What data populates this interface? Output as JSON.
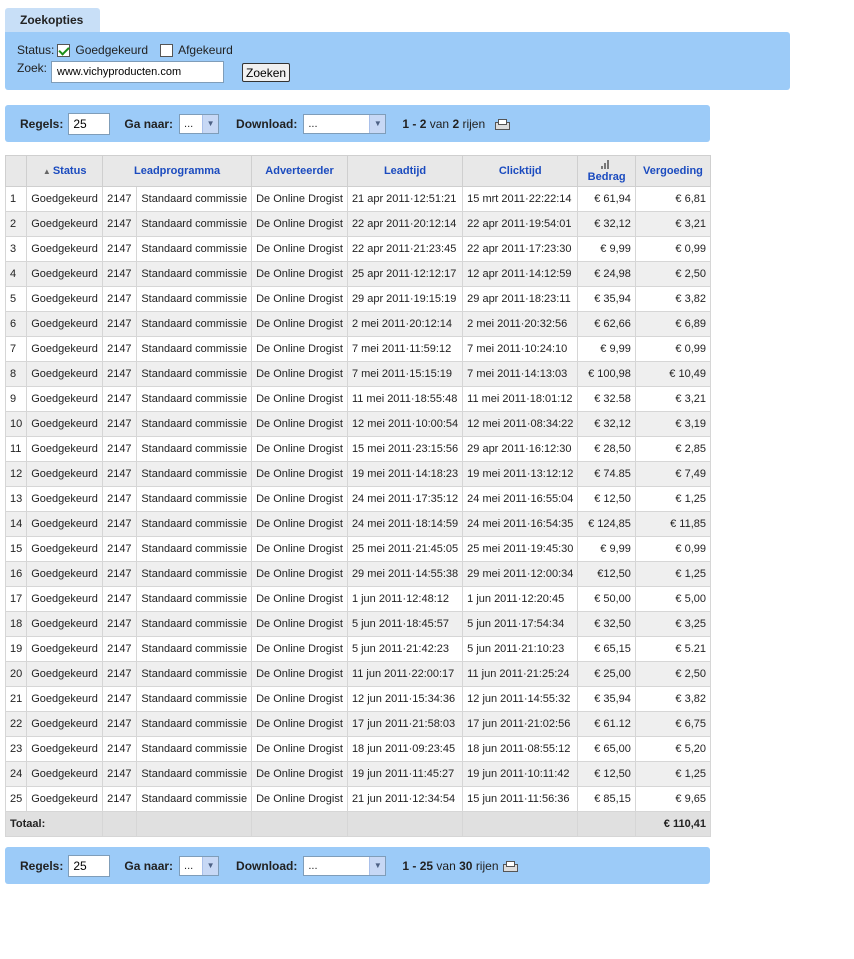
{
  "search": {
    "tab_label": "Zoekopties",
    "status_label": "Status:",
    "goedgekeurd_label": "Goedgekeurd",
    "afgekeurd_label": "Afgekeurd",
    "zoek_label": "Zoek:",
    "zoek_value": "www.vichyproducten.com",
    "zoek_button": "Zoeken"
  },
  "pager_top": {
    "regels_label": "Regels:",
    "regels_value": "25",
    "ganaar_label": "Ga naar:",
    "ganaar_value": "...",
    "download_label": "Download:",
    "download_value": "...",
    "range": "1 - 2",
    "van": "van",
    "total": "2",
    "rijen": "rijen"
  },
  "pager_bottom": {
    "regels_label": "Regels:",
    "regels_value": "25",
    "ganaar_label": "Ga naar:",
    "ganaar_value": "...",
    "download_label": "Download:",
    "download_value": "...",
    "range": "1 - 25",
    "van": "van",
    "total": "30",
    "rijen": "rijen"
  },
  "table": {
    "headers": {
      "status": "Status",
      "leadprogramma": "Leadprogramma",
      "adverteerder": "Adverteerder",
      "leadtijd": "Leadtijd",
      "clicktijd": "Clicktijd",
      "bedrag": "Bedrag",
      "vergoeding": "Vergoeding"
    },
    "rows": [
      [
        "1",
        "Goedgekeurd",
        "2147",
        "Standaard commissie",
        "De Online Drogist",
        "21 apr 2011·12:51:21",
        "15 mrt 2011·22:22:14",
        "€ 61,94",
        "€ 6,81"
      ],
      [
        "2",
        "Goedgekeurd",
        "2147",
        "Standaard commissie",
        "De Online Drogist",
        "22 apr 2011·20:12:14",
        "22 apr 2011·19:54:01",
        "€ 32,12",
        "€ 3,21"
      ],
      [
        "3",
        "Goedgekeurd",
        "2147",
        "Standaard commissie",
        "De Online Drogist",
        "22 apr 2011·21:23:45",
        "22 apr 2011·17:23:30",
        "€ 9,99",
        "€ 0,99"
      ],
      [
        "4",
        "Goedgekeurd",
        "2147",
        "Standaard commissie",
        "De Online Drogist",
        "25 apr 2011·12:12:17",
        "12 apr 2011·14:12:59",
        "€ 24,98",
        "€ 2,50"
      ],
      [
        "5",
        "Goedgekeurd",
        "2147",
        "Standaard commissie",
        "De Online Drogist",
        "29 apr 2011·19:15:19",
        "29 apr 2011·18:23:11",
        "€ 35,94",
        "€ 3,82"
      ],
      [
        "6",
        "Goedgekeurd",
        "2147",
        "Standaard commissie",
        "De Online Drogist",
        "2 mei 2011·20:12:14",
        "2 mei 2011·20:32:56",
        "€ 62,66",
        "€ 6,89"
      ],
      [
        "7",
        "Goedgekeurd",
        "2147",
        "Standaard commissie",
        "De Online Drogist",
        "7 mei 2011·11:59:12",
        "7 mei 2011·10:24:10",
        "€ 9,99",
        "€ 0,99"
      ],
      [
        "8",
        "Goedgekeurd",
        "2147",
        "Standaard commissie",
        "De Online Drogist",
        "7 mei 2011·15:15:19",
        "7 mei 2011·14:13:03",
        "€ 100,98",
        "€ 10,49"
      ],
      [
        "9",
        "Goedgekeurd",
        "2147",
        "Standaard commissie",
        "De Online Drogist",
        "11 mei 2011·18:55:48",
        "11 mei 2011·18:01:12",
        "€ 32.58",
        "€ 3,21"
      ],
      [
        "10",
        "Goedgekeurd",
        "2147",
        "Standaard commissie",
        "De Online Drogist",
        "12 mei 2011·10:00:54",
        "12 mei 2011·08:34:22",
        "€ 32,12",
        "€ 3,19"
      ],
      [
        "11",
        "Goedgekeurd",
        "2147",
        "Standaard commissie",
        "De Online Drogist",
        "15 mei 2011·23:15:56",
        "29 apr 2011·16:12:30",
        "€ 28,50",
        "€ 2,85"
      ],
      [
        "12",
        "Goedgekeurd",
        "2147",
        "Standaard commissie",
        "De Online Drogist",
        "19 mei 2011·14:18:23",
        "19 mei 2011·13:12:12",
        "€ 74.85",
        "€ 7,49"
      ],
      [
        "13",
        "Goedgekeurd",
        "2147",
        "Standaard commissie",
        "De Online Drogist",
        "24 mei 2011·17:35:12",
        "24 mei 2011·16:55:04",
        "€ 12,50",
        "€ 1,25"
      ],
      [
        "14",
        "Goedgekeurd",
        "2147",
        "Standaard commissie",
        "De Online Drogist",
        "24 mei 2011·18:14:59",
        "24 mei 2011·16:54:35",
        "€ 124,85",
        "€ 11,85"
      ],
      [
        "15",
        "Goedgekeurd",
        "2147",
        "Standaard commissie",
        "De Online Drogist",
        "25 mei 2011·21:45:05",
        "25 mei 2011·19:45:30",
        "€ 9,99",
        "€ 0,99"
      ],
      [
        "16",
        "Goedgekeurd",
        "2147",
        "Standaard commissie",
        "De Online Drogist",
        "29 mei 2011·14:55:38",
        "29 mei 2011·12:00:34",
        "€12,50",
        "€ 1,25"
      ],
      [
        "17",
        "Goedgekeurd",
        "2147",
        "Standaard commissie",
        "De Online Drogist",
        "1 jun 2011·12:48:12",
        "1 jun 2011·12:20:45",
        "€ 50,00",
        "€ 5,00"
      ],
      [
        "18",
        "Goedgekeurd",
        "2147",
        "Standaard commissie",
        "De Online Drogist",
        "5 jun 2011·18:45:57",
        "5 jun 2011·17:54:34",
        "€ 32,50",
        "€ 3,25"
      ],
      [
        "19",
        "Goedgekeurd",
        "2147",
        "Standaard commissie",
        "De Online Drogist",
        "5 jun 2011·21:42:23",
        "5 jun 2011·21:10:23",
        "€ 65,15",
        "€ 5.21"
      ],
      [
        "20",
        "Goedgekeurd",
        "2147",
        "Standaard commissie",
        "De Online Drogist",
        "11 jun 2011·22:00:17",
        "11 jun 2011·21:25:24",
        "€ 25,00",
        "€ 2,50"
      ],
      [
        "21",
        "Goedgekeurd",
        "2147",
        "Standaard commissie",
        "De Online Drogist",
        "12 jun 2011·15:34:36",
        "12 jun 2011·14:55:32",
        "€ 35,94",
        "€ 3,82"
      ],
      [
        "22",
        "Goedgekeurd",
        "2147",
        "Standaard commissie",
        "De Online Drogist",
        "17 jun 2011·21:58:03",
        "17 jun 2011·21:02:56",
        "€ 61.12",
        "€ 6,75"
      ],
      [
        "23",
        "Goedgekeurd",
        "2147",
        "Standaard commissie",
        "De Online Drogist",
        "18 jun 2011·09:23:45",
        "18 jun 2011·08:55:12",
        "€ 65,00",
        "€ 5,20"
      ],
      [
        "24",
        "Goedgekeurd",
        "2147",
        "Standaard commissie",
        "De Online Drogist",
        "19 jun 2011·11:45:27",
        "19 jun 2011·10:11:42",
        "€ 12,50",
        "€ 1,25"
      ],
      [
        "25",
        "Goedgekeurd",
        "2147",
        "Standaard commissie",
        "De Online Drogist",
        "21 jun 2011·12:34:54",
        "15 jun 2011·11:56:36",
        "€ 85,15",
        "€ 9,65"
      ]
    ],
    "total_label": "Totaal:",
    "total_value": "€ 110,41"
  }
}
